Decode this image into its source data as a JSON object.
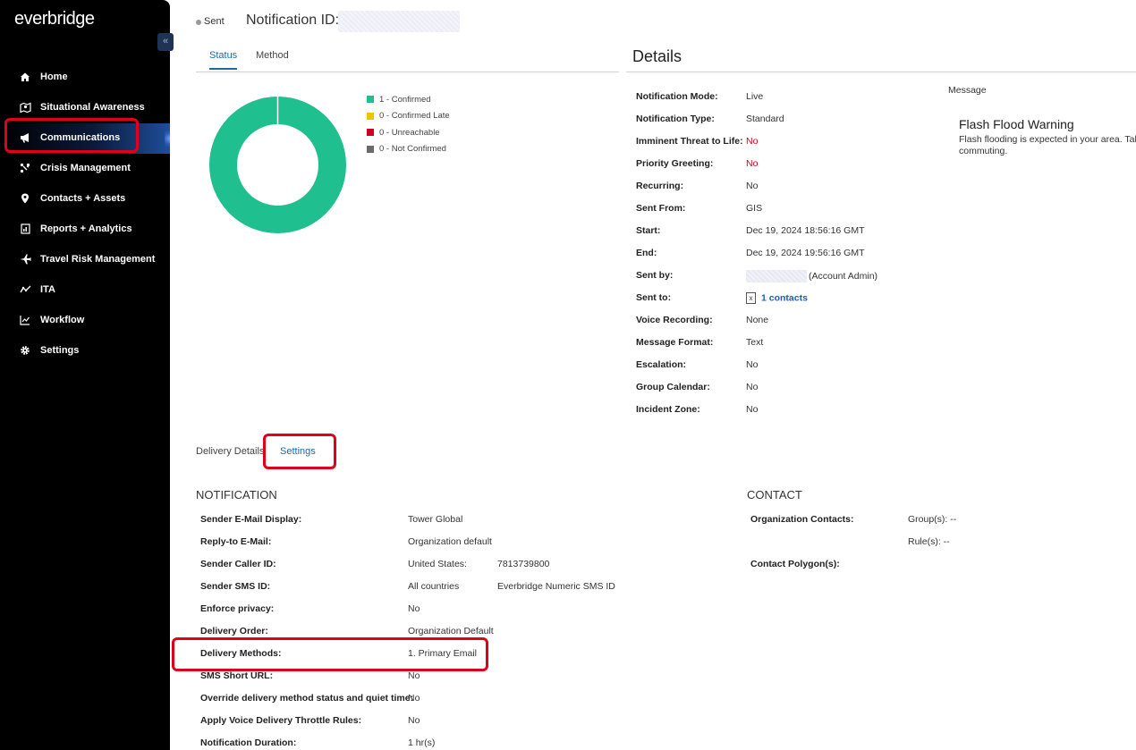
{
  "brand": {
    "logo_text": "everbridge"
  },
  "sidebar": {
    "collapse_glyph": "«",
    "items": [
      {
        "label": "Home",
        "icon": "home-icon"
      },
      {
        "label": "Situational Awareness",
        "icon": "map-icon"
      },
      {
        "label": "Communications",
        "icon": "megaphone-icon",
        "active": true
      },
      {
        "label": "Crisis Management",
        "icon": "crisis-icon"
      },
      {
        "label": "Contacts + Assets",
        "icon": "location-pin-icon"
      },
      {
        "label": "Reports + Analytics",
        "icon": "report-icon"
      },
      {
        "label": "Travel Risk Management",
        "icon": "plane-icon"
      },
      {
        "label": "ITA",
        "icon": "ita-icon"
      },
      {
        "label": "Workflow",
        "icon": "chart-line-icon"
      },
      {
        "label": "Settings",
        "icon": "gear-icon"
      }
    ]
  },
  "header": {
    "status": "Sent",
    "notification_id_label": "Notification ID:"
  },
  "tabs": [
    {
      "label": "Status",
      "active": true
    },
    {
      "label": "Method",
      "active": false
    }
  ],
  "status_chart": {
    "legend": [
      {
        "label": "1 - Confirmed",
        "color": "#1fbf8f"
      },
      {
        "label": "0 - Confirmed Late",
        "color": "#f2c200"
      },
      {
        "label": "0 - Unreachable",
        "color": "#d0021b"
      },
      {
        "label": "0 - Not Confirmed",
        "color": "#6b6b6b"
      }
    ],
    "confirmed": 1,
    "confirmed_late": 0,
    "unreachable": 0,
    "not_confirmed": 0
  },
  "details": {
    "title": "Details",
    "rows": [
      {
        "label": "Notification Mode:",
        "value": "Live"
      },
      {
        "label": "Notification Type:",
        "value": "Standard"
      },
      {
        "label": "Imminent Threat to Life:",
        "value": "No",
        "red": true
      },
      {
        "label": "Priority Greeting:",
        "value": "No",
        "red": true
      },
      {
        "label": "Recurring:",
        "value": "No"
      },
      {
        "label": "Sent From:",
        "value": "GIS"
      },
      {
        "label": "Start:",
        "value": "Dec 19, 2024 18:56:16 GMT"
      },
      {
        "label": "End:",
        "value": "Dec 19, 2024 19:56:16 GMT"
      },
      {
        "label": "Sent by:",
        "value": "(Account Admin)"
      },
      {
        "label": "Sent to:",
        "value": "1  contacts"
      },
      {
        "label": "Voice Recording:",
        "value": "None"
      },
      {
        "label": "Message Format:",
        "value": "Text"
      },
      {
        "label": "Escalation:",
        "value": "No"
      },
      {
        "label": "Group Calendar:",
        "value": "No"
      },
      {
        "label": "Incident Zone:",
        "value": "No"
      }
    ]
  },
  "message": {
    "label": "Message",
    "title": "Flash Flood Warning",
    "body_line1": "Flash flooding is expected in your area. Take",
    "body_line2": "commuting."
  },
  "sub_tabs": {
    "delivery": "Delivery Details",
    "settings": "Settings"
  },
  "notification_section": {
    "title": "NOTIFICATION",
    "rows": [
      {
        "label": "Sender E-Mail Display:",
        "value": "Tower Global",
        "value2": ""
      },
      {
        "label": "Reply-to E-Mail:",
        "value": "Organization default",
        "value2": ""
      },
      {
        "label": "Sender Caller ID:",
        "value": "United States:",
        "value2": "7813739800"
      },
      {
        "label": "Sender SMS ID:",
        "value": "All countries",
        "value2": "Everbridge Numeric SMS ID"
      },
      {
        "label": "Enforce privacy:",
        "value": "No",
        "value2": ""
      },
      {
        "label": "Delivery Order:",
        "value": "Organization Default",
        "value2": ""
      },
      {
        "label": "Delivery Methods:",
        "value": "1. Primary Email",
        "value2": ""
      },
      {
        "label": "SMS Short URL:",
        "value": "No",
        "value2": ""
      },
      {
        "label": "Override delivery method status and quiet time:",
        "value": "No",
        "value2": ""
      },
      {
        "label": "Apply Voice Delivery Throttle Rules:",
        "value": "No",
        "value2": ""
      },
      {
        "label": "Notification Duration:",
        "value": "1 hr(s)",
        "value2": ""
      }
    ]
  },
  "contact_section": {
    "title": "CONTACT",
    "rows": [
      {
        "label": "Organization Contacts:",
        "value": "Group(s): --"
      },
      {
        "label": "",
        "value": "Rule(s): --"
      },
      {
        "label": "Contact Polygon(s):",
        "value": ""
      }
    ]
  }
}
